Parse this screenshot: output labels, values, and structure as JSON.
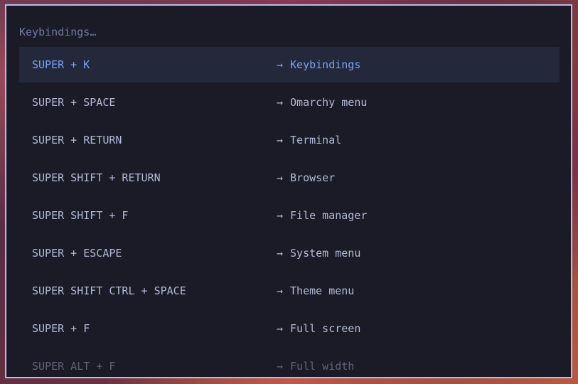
{
  "launcher": {
    "search_placeholder": "Keybindings…",
    "arrow_icon": "→"
  },
  "results": [
    {
      "keys": "SUPER + K",
      "action": "Keybindings",
      "selected": true
    },
    {
      "keys": "SUPER + SPACE",
      "action": "Omarchy menu"
    },
    {
      "keys": "SUPER + RETURN",
      "action": "Terminal"
    },
    {
      "keys": "SUPER SHIFT + RETURN",
      "action": "Browser"
    },
    {
      "keys": "SUPER SHIFT + F",
      "action": "File manager"
    },
    {
      "keys": "SUPER + ESCAPE",
      "action": "System menu"
    },
    {
      "keys": "SUPER SHIFT CTRL + SPACE",
      "action": "Theme menu"
    },
    {
      "keys": "SUPER + F",
      "action": "Full screen"
    },
    {
      "keys": "SUPER ALT + F",
      "action": "Full width"
    }
  ],
  "colors": {
    "panel_bg": "#1a1b26",
    "border": "#b7bde8",
    "selected_bg": "#24283b",
    "selected_text": "#7aa2f7",
    "text": "#b4b9d6",
    "placeholder": "#737aa2"
  }
}
